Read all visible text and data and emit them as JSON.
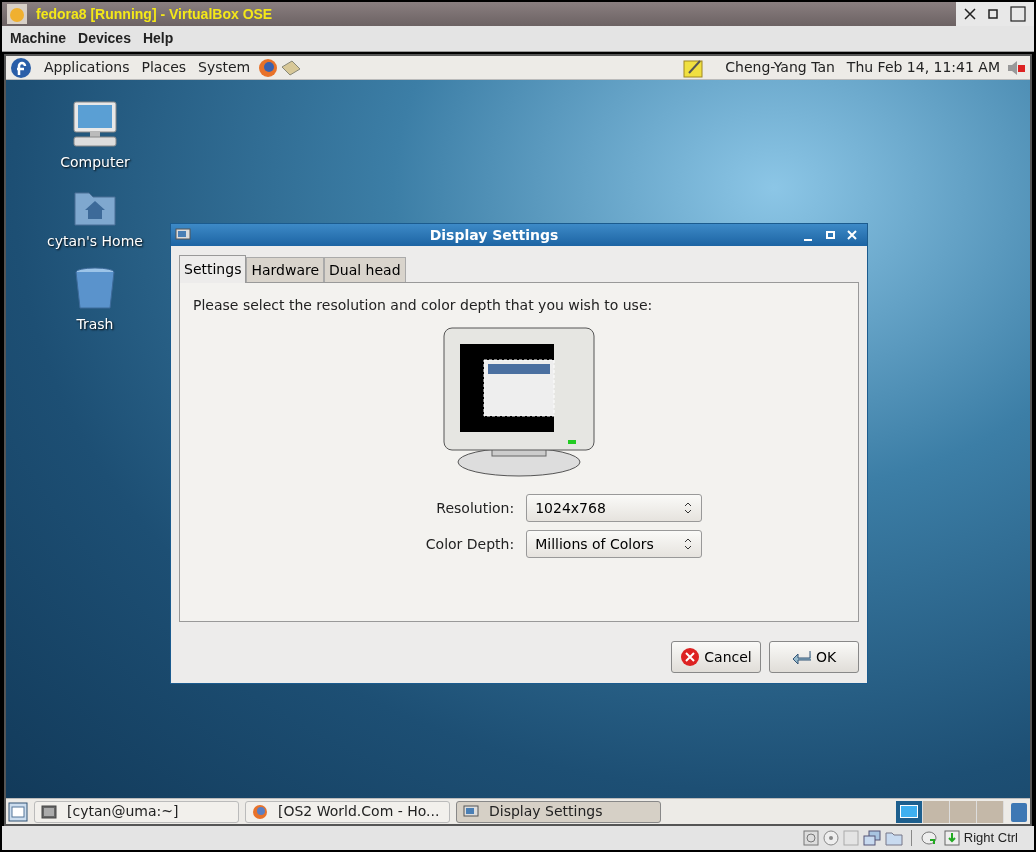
{
  "window": {
    "title": "fedora8 [Running] - VirtualBox OSE"
  },
  "menu": [
    "Machine",
    "Devices",
    "Help"
  ],
  "top_panel": {
    "menus": [
      "Applications",
      "Places",
      "System"
    ],
    "user": "Cheng-Yang Tan",
    "clock": "Thu Feb 14, 11:41 AM"
  },
  "desktop_icons": [
    {
      "kind": "computer",
      "label": "Computer"
    },
    {
      "kind": "home",
      "label": "cytan's Home"
    },
    {
      "kind": "trash",
      "label": "Trash"
    }
  ],
  "dialog": {
    "title": "Display Settings",
    "tabs": [
      {
        "label": "Settings",
        "selected": true
      },
      {
        "label": "Hardware",
        "selected": false
      },
      {
        "label": "Dual head",
        "selected": false
      }
    ],
    "prompt": "Please select the resolution and color depth that you wish to use:",
    "fields": [
      {
        "label": "Resolution:",
        "value": "1024x768"
      },
      {
        "label": "Color Depth:",
        "value": "Millions of Colors"
      }
    ],
    "buttons": [
      {
        "kind": "cancel",
        "label": "Cancel"
      },
      {
        "kind": "ok",
        "label": "OK"
      }
    ]
  },
  "taskbar": [
    {
      "kind": "terminal",
      "label": "[cytan@uma:~]",
      "selected": false
    },
    {
      "kind": "browser",
      "label": "[OS2 World.Com - Ho...",
      "selected": false
    },
    {
      "kind": "display",
      "label": "Display Settings",
      "selected": true
    }
  ],
  "workspaces": [
    {
      "selected": true
    },
    {
      "selected": false
    },
    {
      "selected": false
    },
    {
      "selected": false
    }
  ],
  "status_bar": {
    "host_key": "Right Ctrl"
  }
}
